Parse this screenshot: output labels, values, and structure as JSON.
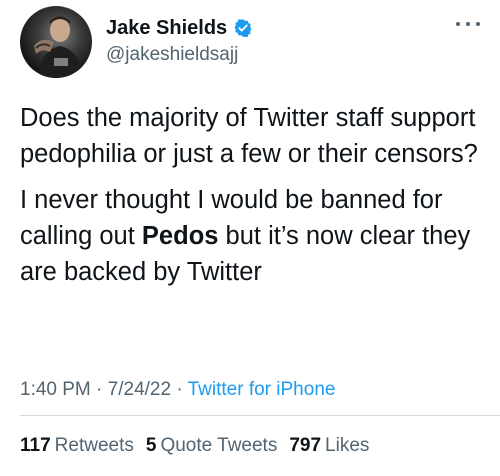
{
  "author": {
    "display_name": "Jake Shields",
    "handle": "@jakeshieldsajj",
    "verified": true
  },
  "tweet": {
    "paragraph1": "Does the majority of Twitter staff support pedophilia or just a few or their censors?",
    "paragraph2_before": "I never thought I would be banned for calling out ",
    "paragraph2_bold": "Pedos",
    "paragraph2_after": " but it’s now clear they are backed by Twitter"
  },
  "meta": {
    "time": "1:40 PM",
    "date": "7/24/22",
    "separator": "·",
    "source": "Twitter for iPhone"
  },
  "stats": {
    "retweets_count": "117",
    "retweets_label": "Retweets",
    "quotes_count": "5",
    "quotes_label": "Quote Tweets",
    "likes_count": "797",
    "likes_label": "Likes"
  },
  "colors": {
    "accent": "#1d9bf0",
    "text": "#0f1419",
    "secondary": "#536471"
  }
}
